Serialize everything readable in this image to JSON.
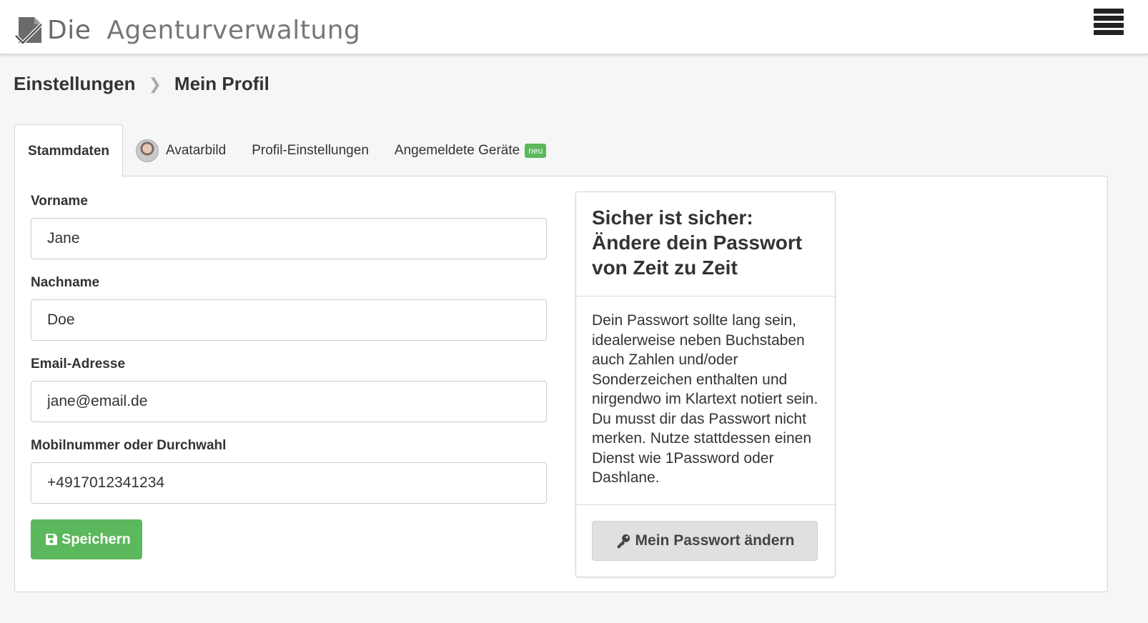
{
  "app": {
    "logo_word1": "Die",
    "logo_word2": "Agenturverwaltung"
  },
  "breadcrumb": {
    "parent": "Einstellungen",
    "current": "Mein Profil"
  },
  "tabs": [
    {
      "label": "Stammdaten",
      "active": true
    },
    {
      "label": "Avatarbild",
      "icon": "avatar-icon"
    },
    {
      "label": "Profil-Einstellungen"
    },
    {
      "label": "Angemeldete Geräte",
      "badge": "neu"
    }
  ],
  "form": {
    "firstname_label": "Vorname",
    "firstname_value": "Jane",
    "lastname_label": "Nachname",
    "lastname_value": "Doe",
    "email_label": "Email-Adresse",
    "email_value": "jane@email.de",
    "phone_label": "Mobilnummer oder Durchwahl",
    "phone_value": "+4917012341234",
    "save_label": "Speichern",
    "save_icon": "save-icon"
  },
  "password_card": {
    "title_line1": "Sicher ist sicher:",
    "title_line2": "Ändere dein Passwort",
    "title_line3": "von Zeit zu Zeit",
    "text": "Dein Passwort sollte lang sein, idealerweise neben Buchstaben auch Zahlen und/oder Sonderzeichen enthalten und nirgendwo im Klartext notiert sein. Du musst dir das Passwort nicht merken. Nutze stattdessen einen Dienst wie 1Password oder Dashlane.",
    "button_label": "Mein Passwort ändern",
    "button_icon": "key-icon"
  },
  "colors": {
    "accent_green": "#5cb85c",
    "page_bg": "#f6f6f6"
  }
}
